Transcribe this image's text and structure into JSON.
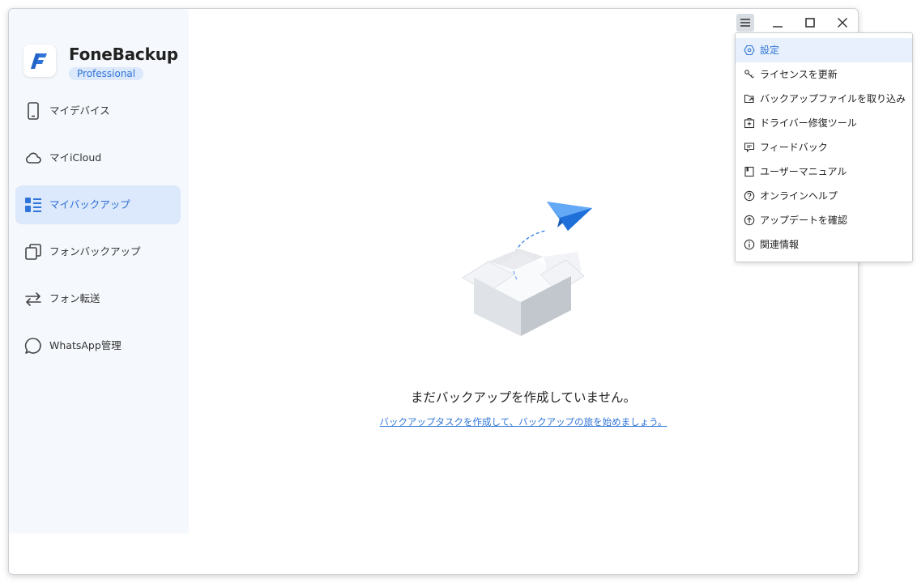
{
  "app": {
    "name": "FoneBackup",
    "edition": "Professional"
  },
  "sidebar": {
    "items": [
      {
        "label": "マイデバイス",
        "icon": "phone-icon",
        "active": false
      },
      {
        "label": "マイiCloud",
        "icon": "cloud-icon",
        "active": false
      },
      {
        "label": "マイバックアップ",
        "icon": "backup-list-icon",
        "active": true
      },
      {
        "label": "フォンバックアップ",
        "icon": "copy-icon",
        "active": false
      },
      {
        "label": "フォン転送",
        "icon": "transfer-arrows-icon",
        "active": false
      },
      {
        "label": "WhatsApp管理",
        "icon": "chat-bubble-icon",
        "active": false
      }
    ]
  },
  "main": {
    "empty_title": "まだバックアップを作成していません。",
    "empty_link": "バックアップタスクを作成して、バックアップの旅を始めましょう。"
  },
  "menu": {
    "items": [
      {
        "label": "設定",
        "icon": "settings-icon",
        "active": true
      },
      {
        "label": "ライセンスを更新",
        "icon": "key-icon",
        "active": false
      },
      {
        "label": "バックアップファイルを取り込み",
        "icon": "import-folder-icon",
        "active": false
      },
      {
        "label": "ドライバー修復ツール",
        "icon": "driver-repair-icon",
        "active": false
      },
      {
        "label": "フィードバック",
        "icon": "feedback-icon",
        "active": false
      },
      {
        "label": "ユーザーマニュアル",
        "icon": "manual-icon",
        "active": false
      },
      {
        "label": "オンラインヘルプ",
        "icon": "help-icon",
        "active": false
      },
      {
        "label": "アップデートを確認",
        "icon": "update-icon",
        "active": false
      },
      {
        "label": "関連情報",
        "icon": "info-icon",
        "active": false
      }
    ]
  },
  "colors": {
    "accent": "#2f74d8",
    "active_bg": "#dce8fb",
    "sidebar_bg": "#f5f8fc"
  }
}
